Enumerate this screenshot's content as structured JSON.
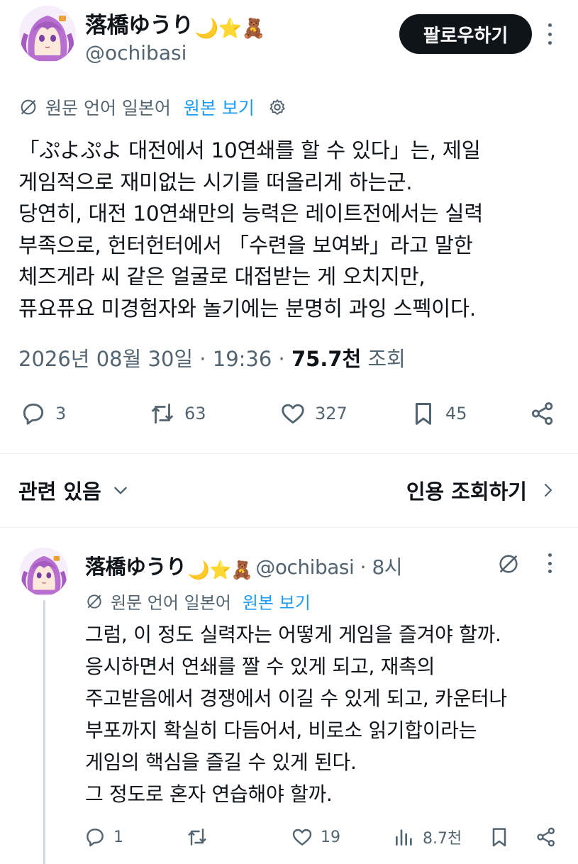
{
  "post": {
    "author_name": "落橋ゆうり",
    "badges": "🌙⭐🧸",
    "handle": "@ochibasi",
    "follow_label": "팔로우하기",
    "translate": {
      "language_note": "원문 언어 일본어",
      "show_original": "원본 보기"
    },
    "text_lines": [
      "「ぷよぷよ 대전에서 10연쇄를 할 수 있다」는, 제일",
      "게임적으로 재미없는 시기를 떠올리게 하는군.",
      "당연히, 대전 10연쇄만의 능력은 레이트전에서는 실력",
      "부족으로, 헌터헌터에서 「수련을 보여봐」라고 말한",
      "체즈게라 씨 같은 얼굴로 대접받는 게 오치지만,",
      "퓨요퓨요 미경험자와 놀기에는 분명히 과잉 스펙이다."
    ],
    "meta": {
      "timestamp": "2026년 08월 30일 · 19:36 · ",
      "views": "75.7천",
      "views_suffix": " 조회"
    },
    "actions": {
      "replies": "3",
      "reposts": "63",
      "likes": "327",
      "bookmarks": "45"
    }
  },
  "related": {
    "label": "관련 있음",
    "quotes_label": "인용 조회하기"
  },
  "reply": {
    "author_name": "落橋ゆうり",
    "badges": "🌙⭐🧸",
    "handle_time": "@ochibasi · 8시",
    "translate": {
      "language_note": "원문 언어 일본어",
      "show_original": "원본 보기"
    },
    "text_lines": [
      "그럼, 이 정도 실력자는 어떻게 게임을 즐겨야 할까.",
      "응시하면서 연쇄를 짤 수 있게 되고, 재촉의",
      "주고받음에서 경쟁에서 이길 수 있게 되고, 카운터나",
      "부포까지 확실히 다듬어서, 비로소 읽기합이라는",
      "게임의 핵심을 즐길 수 있게 된다.",
      "그 정도로 혼자 연습해야 할까."
    ],
    "actions": {
      "replies": "1",
      "reposts": "",
      "likes": "19",
      "views": "8.7천"
    }
  },
  "colors": {
    "text": "#0f1419",
    "muted": "#536471",
    "link": "#1d9bf0",
    "follow_bg": "#0f1419",
    "avatar_hair": "#b86fd0"
  }
}
